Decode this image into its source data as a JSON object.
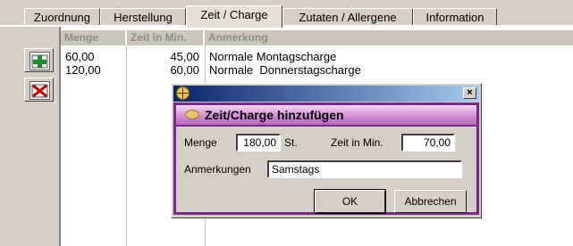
{
  "tabs": [
    {
      "label": "Zuordnung"
    },
    {
      "label": "Herstellung"
    },
    {
      "label": "Zeit / Charge"
    },
    {
      "label": "Zutaten / Allergene"
    },
    {
      "label": "Information"
    }
  ],
  "active_tab": "Zeit / Charge",
  "toolbar": {
    "add_icon": "add-row-icon",
    "delete_icon": "delete-row-icon"
  },
  "grid": {
    "columns": [
      "Menge",
      "Zeit in Min.",
      "Anmerkung"
    ],
    "rows": [
      {
        "menge": "60,00",
        "zeit": "45,00",
        "anmerkung": "Normale Montagscharge"
      },
      {
        "menge": "120,00",
        "zeit": "60,00",
        "anmerkung": "Normale  Donnerstagscharge"
      }
    ]
  },
  "dialog": {
    "close_glyph": "×",
    "title": "Zeit/Charge hinzufügen",
    "menge_label": "Menge",
    "menge_value": "180,00",
    "menge_unit": "St.",
    "zeit_label": "Zeit in Min.",
    "zeit_value": "70,00",
    "anmerkungen_label": "Anmerkungen",
    "anmerkungen_value": "Samstags",
    "ok_label": "OK",
    "cancel_label": "Abbrechen"
  },
  "colors": {
    "accent_purple": "#7a2a86",
    "title_blue": "#0a246a"
  }
}
